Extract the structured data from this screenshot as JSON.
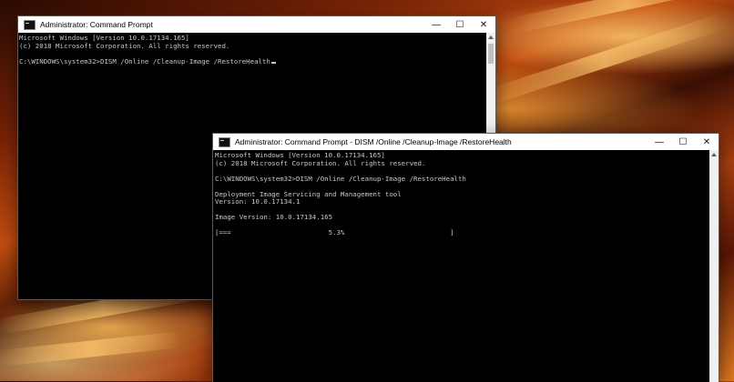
{
  "windows": [
    {
      "title": "Administrator: Command Prompt",
      "controls": {
        "minimize": "—",
        "maximize": "☐",
        "close": "✕"
      },
      "lines": [
        "Microsoft Windows [Version 10.0.17134.165]",
        "(c) 2018 Microsoft Corporation. All rights reserved.",
        "",
        "C:\\WINDOWS\\system32>DISM /Online /Cleanup-Image /RestoreHealth"
      ]
    },
    {
      "title": "Administrator: Command Prompt - DISM /Online /Cleanup-Image /RestoreHealth",
      "controls": {
        "minimize": "—",
        "maximize": "☐",
        "close": "✕"
      },
      "lines": [
        "Microsoft Windows [Version 10.0.17134.165]",
        "(c) 2018 Microsoft Corporation. All rights reserved.",
        "",
        "C:\\WINDOWS\\system32>DISM /Online /Cleanup-Image /RestoreHealth",
        "",
        "Deployment Image Servicing and Management tool",
        "Version: 10.0.17134.1",
        "",
        "Image Version: 10.0.17134.165",
        "",
        "[===                        5.3%                          ]"
      ]
    }
  ],
  "icons": {
    "app": "command-prompt-icon",
    "scroll_up": "chevron-up-icon"
  }
}
